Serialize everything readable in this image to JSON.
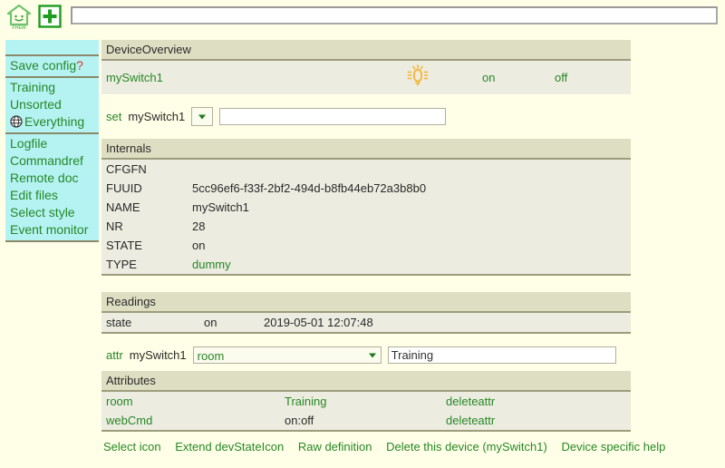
{
  "header": {
    "logo_alt": "FHEM",
    "logo_caption": "FHEM",
    "add_icon": "plus-icon",
    "command_input_value": "",
    "command_input_placeholder": ""
  },
  "sidebar": {
    "groups": [
      {
        "items": [
          {
            "label": "Save config",
            "suffix": "?",
            "icon": null
          }
        ]
      },
      {
        "items": [
          {
            "label": "Training",
            "icon": null
          },
          {
            "label": "Unsorted",
            "icon": null
          },
          {
            "label": "Everything",
            "icon": "globe-icon"
          }
        ]
      },
      {
        "items": [
          {
            "label": "Logfile",
            "icon": null
          },
          {
            "label": "Commandref",
            "icon": null
          },
          {
            "label": "Remote doc",
            "icon": null
          },
          {
            "label": "Edit files",
            "icon": null
          },
          {
            "label": "Select style",
            "icon": null
          },
          {
            "label": "Event monitor",
            "icon": null
          }
        ]
      }
    ]
  },
  "device_overview": {
    "title": "DeviceOverview",
    "device_name": "mySwitch1",
    "state_icon": "light-bulb-on-icon",
    "webcmd": [
      "on",
      "off"
    ]
  },
  "set_line": {
    "keyword": "set",
    "device": "mySwitch1",
    "select_value": "",
    "arg_value": "",
    "arg_placeholder": ""
  },
  "internals": {
    "title": "Internals",
    "rows": [
      {
        "key": "CFGFN",
        "value": ""
      },
      {
        "key": "FUUID",
        "value": "5cc96ef6-f33f-2bf2-494d-b8fb44eb72a3b8b0"
      },
      {
        "key": "NAME",
        "value": "mySwitch1"
      },
      {
        "key": "NR",
        "value": "28"
      },
      {
        "key": "STATE",
        "value": "on"
      },
      {
        "key": "TYPE",
        "value": "dummy",
        "link": true
      }
    ]
  },
  "readings": {
    "title": "Readings",
    "rows": [
      {
        "name": "state",
        "value": "on",
        "timestamp": "2019-05-01 12:07:48"
      }
    ]
  },
  "attr_line": {
    "keyword": "attr",
    "device": "mySwitch1",
    "select_value": "room",
    "value": "Training"
  },
  "attributes": {
    "title": "Attributes",
    "delete_label": "deleteattr",
    "rows": [
      {
        "name": "room",
        "value": "Training",
        "value_link": true,
        "action": "deleteattr"
      },
      {
        "name": "webCmd",
        "value": "on:off",
        "value_link": false,
        "action": "deleteattr"
      }
    ]
  },
  "bottom_links": [
    "Select icon",
    "Extend devStateIcon",
    "Raw definition",
    "Delete this device (mySwitch1)",
    "Device specific help"
  ],
  "colors": {
    "link_green": "#278727",
    "sidebar_cyan": "#b5f3f3",
    "page_background": "#ffffe7",
    "table_header": "#dedec3",
    "table_row": "#ecece0",
    "bulb_orange": "#f5b942",
    "accent_red": "#e03030"
  }
}
